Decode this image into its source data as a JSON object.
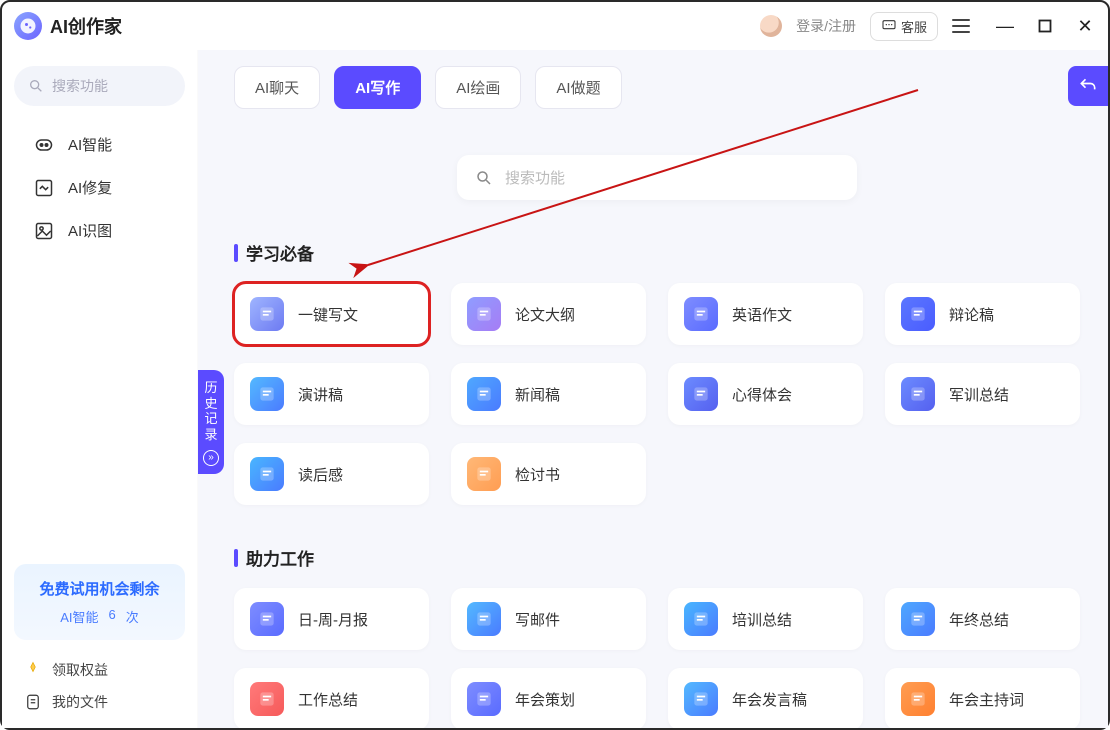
{
  "app": {
    "title": "AI创作家"
  },
  "header": {
    "login_text": "登录/注册",
    "kefu_label": "客服"
  },
  "sidebar": {
    "search_placeholder": "搜索功能",
    "items": [
      {
        "label": "AI智能"
      },
      {
        "label": "AI修复"
      },
      {
        "label": "AI识图"
      }
    ],
    "trial": {
      "title": "免费试用机会剩余",
      "line2_a": "AI智能",
      "line2_b": "6",
      "line2_c": "次"
    },
    "bottom": [
      {
        "label": "领取权益"
      },
      {
        "label": "我的文件"
      }
    ]
  },
  "tabs": [
    {
      "label": "AI聊天",
      "active": false
    },
    {
      "label": "AI写作",
      "active": true
    },
    {
      "label": "AI绘画",
      "active": false
    },
    {
      "label": "AI做题",
      "active": false
    }
  ],
  "center_search_placeholder": "搜索功能",
  "history_tab": "历史记录",
  "sections": [
    {
      "title": "学习必备",
      "cards": [
        {
          "label": "一键写文",
          "bg": "linear-gradient(135deg,#9fb5ff,#6d7af2)",
          "highlighted": true
        },
        {
          "label": "论文大纲",
          "bg": "linear-gradient(135deg,#8f9dff,#a67cf5)"
        },
        {
          "label": "英语作文",
          "bg": "linear-gradient(135deg,#7e8dff,#5a6bff)"
        },
        {
          "label": "辩论稿",
          "bg": "linear-gradient(135deg,#5b77ff,#4a5cff)"
        },
        {
          "label": "演讲稿",
          "bg": "linear-gradient(135deg,#53b9ff,#4b7bff)"
        },
        {
          "label": "新闻稿",
          "bg": "linear-gradient(135deg,#4fa8ff,#4a7bff)"
        },
        {
          "label": "心得体会",
          "bg": "linear-gradient(135deg,#6c8bff,#5560ef)"
        },
        {
          "label": "军训总结",
          "bg": "linear-gradient(135deg,#6c8bff,#5560ef)"
        },
        {
          "label": "读后感",
          "bg": "linear-gradient(135deg,#49b6ff,#4a7bff)"
        },
        {
          "label": "检讨书",
          "bg": "linear-gradient(135deg,#ffb877,#ff9d52)"
        }
      ]
    },
    {
      "title": "助力工作",
      "cards": [
        {
          "label": "日-周-月报",
          "bg": "linear-gradient(135deg,#7e8dff,#5a6bff)"
        },
        {
          "label": "写邮件",
          "bg": "linear-gradient(135deg,#53b9ff,#4a7bff)"
        },
        {
          "label": "培训总结",
          "bg": "linear-gradient(135deg,#49b6ff,#4a7bff)"
        },
        {
          "label": "年终总结",
          "bg": "linear-gradient(135deg,#4fa8ff,#4a7bff)"
        },
        {
          "label": "工作总结",
          "bg": "linear-gradient(135deg,#ff7a7a,#f65a5a)"
        },
        {
          "label": "年会策划",
          "bg": "linear-gradient(135deg,#7e8dff,#5a6bff)"
        },
        {
          "label": "年会发言稿",
          "bg": "linear-gradient(135deg,#53b9ff,#4a7bff)"
        },
        {
          "label": "年会主持词",
          "bg": "linear-gradient(135deg,#ff9d52,#ff8030)"
        }
      ]
    }
  ]
}
